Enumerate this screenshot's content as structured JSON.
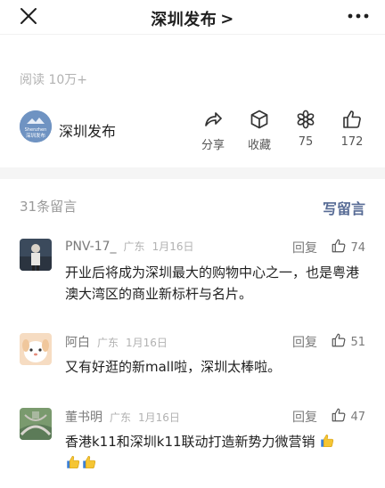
{
  "topbar": {
    "title": "深圳发布",
    "title_chevron": ">"
  },
  "article": {
    "reads": "阅读 10万+"
  },
  "author": {
    "name": "深圳发布",
    "avatar_text_en": "Shenzhen",
    "avatar_text_cn": "深圳发布"
  },
  "actions": {
    "share": {
      "label": "分享",
      "icon": "share-icon"
    },
    "favorite": {
      "label": "收藏",
      "icon": "cube-icon"
    },
    "wow": {
      "label": "75",
      "icon": "flower-icon"
    },
    "like": {
      "label": "172",
      "icon": "thumb-icon"
    }
  },
  "comments_header": {
    "count": "31条留言",
    "write": "写留言"
  },
  "comments": [
    {
      "name": "PNV-17_",
      "region": "广东",
      "date": "1月16日",
      "reply": "回复",
      "likes": "74",
      "text": "开业后将成为深圳最大的购物中心之一，也是粤港澳大湾区的商业新标杆与名片。"
    },
    {
      "name": "阿白",
      "region": "广东",
      "date": "1月16日",
      "reply": "回复",
      "likes": "51",
      "text": "又有好逛的新mall啦，深圳太棒啦。"
    },
    {
      "name": "董书明",
      "region": "广东",
      "date": "1月16日",
      "reply": "回复",
      "likes": "47",
      "text": "香港k11和深圳k11联动打造新势力微营销"
    }
  ],
  "colors": {
    "link": "#576b95",
    "muted": "#b2b2b2",
    "gap": "#f5f5f5"
  }
}
